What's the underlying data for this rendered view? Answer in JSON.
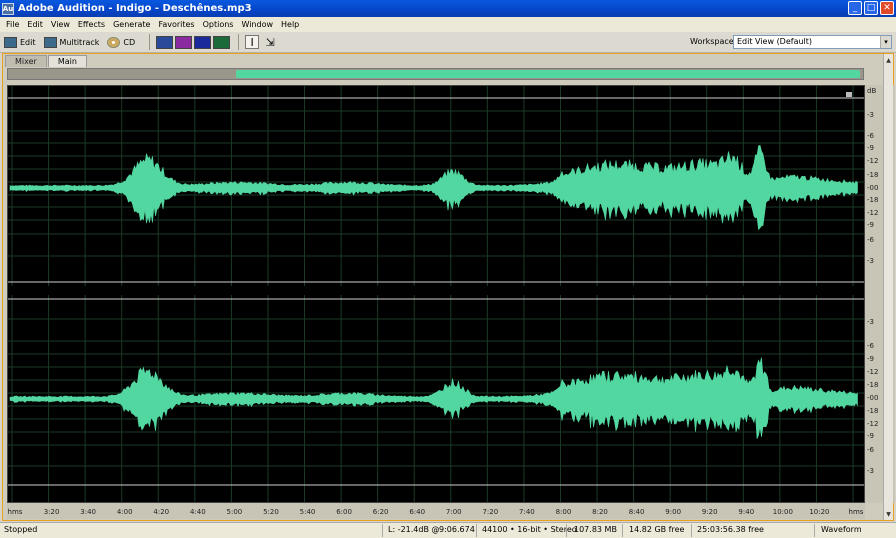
{
  "window": {
    "app_icon": "Au",
    "title": "Adobe Audition - Indigo - Deschênes.mp3",
    "minimize_icon": "_",
    "maximize_icon": "□",
    "close_icon": "✕"
  },
  "menu": [
    "File",
    "Edit",
    "View",
    "Effects",
    "Generate",
    "Favorites",
    "Options",
    "Window",
    "Help"
  ],
  "toolbar": {
    "edit_label": "Edit",
    "multitrack_label": "Multitrack",
    "cd_label": "CD",
    "time_selection_icon": "I",
    "move_icon": "⇲",
    "workspace_label": "Workspace:",
    "workspace_value": "Edit View (Default)",
    "workspace_arrow": "▾"
  },
  "tabs": [
    "Mixer",
    "Main"
  ],
  "db_labels_top": [
    "dB",
    "-3",
    "-6",
    "-9",
    "-12",
    "-18",
    "-00",
    "-18",
    "-12",
    "-9",
    "-6",
    "-3"
  ],
  "db_labels_bottom": [
    "-3",
    "-6",
    "-9",
    "-12",
    "-18",
    "-00",
    "-18",
    "-12",
    "-9",
    "-6",
    "-3"
  ],
  "time_labels": [
    "hms",
    "3:20",
    "3:40",
    "4:00",
    "4:20",
    "4:40",
    "5:00",
    "5:20",
    "5:40",
    "6:00",
    "6:20",
    "6:40",
    "7:00",
    "7:20",
    "7:40",
    "8:00",
    "8:20",
    "8:40",
    "9:00",
    "9:20",
    "9:40",
    "10:00",
    "10:20",
    "hms"
  ],
  "status": {
    "state": "Stopped",
    "level": "L: -21.4dB @",
    "position": "9:06.674",
    "format": "44100 • 16-bit • Stereo",
    "size": "107.83 MB",
    "free_space": "14.82 GB free",
    "free_time": "25:03:56.38 free",
    "view": "Waveform"
  },
  "colors": {
    "waveform": "#52d7a1",
    "background": "#000000",
    "title_bar": "#0a58e0",
    "frame_border": "#e8a020"
  },
  "scroll": {
    "up_icon": "▲",
    "down_icon": "▼"
  }
}
